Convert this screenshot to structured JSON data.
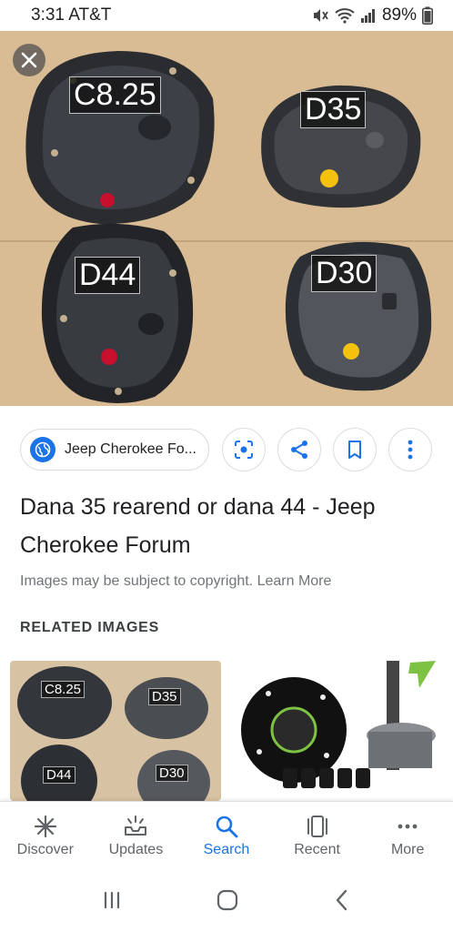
{
  "status_bar": {
    "time": "3:31",
    "carrier": "AT&T",
    "battery": "89%"
  },
  "hero": {
    "labels": {
      "c825": "C8.25",
      "d35": "D35",
      "d44": "D44",
      "d30": "D30"
    }
  },
  "source": {
    "site_name": "Jeep Cherokee Fo..."
  },
  "result": {
    "title": "Dana 35 rearend or dana 44 - Jeep Cherokee Forum",
    "copyright_notice": "Images may be subject to copyright. Learn More"
  },
  "related": {
    "heading": "RELATED IMAGES",
    "thumb1_labels": {
      "c825": "C8.25",
      "d35": "D35",
      "d44": "D44",
      "d30": "D30"
    }
  },
  "bottom_nav": {
    "items": [
      {
        "label": "Discover",
        "icon": "asterisk-icon"
      },
      {
        "label": "Updates",
        "icon": "updates-tray-icon"
      },
      {
        "label": "Search",
        "icon": "search-icon"
      },
      {
        "label": "Recent",
        "icon": "recent-cards-icon"
      },
      {
        "label": "More",
        "icon": "more-horizontal-icon"
      }
    ],
    "active_color": "#1a73e8"
  },
  "colors": {
    "accent": "#1a73e8",
    "hero_background": "#d9bb94"
  }
}
